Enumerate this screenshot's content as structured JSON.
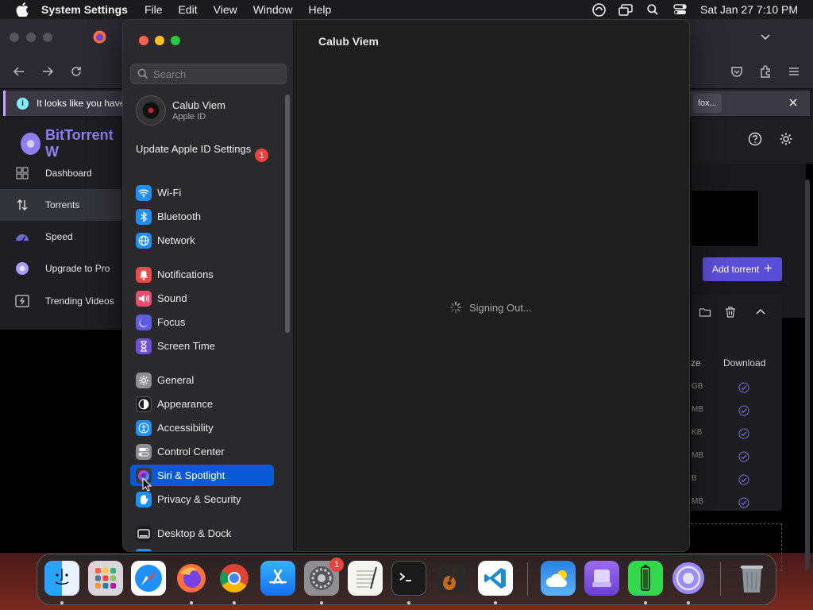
{
  "menubar": {
    "app_name": "System Settings",
    "menus": [
      "File",
      "Edit",
      "View",
      "Window",
      "Help"
    ],
    "clock": "Sat Jan 27  7:10 PM"
  },
  "browser": {
    "infobar_text": "It looks like you have",
    "infobar_button": "fox...",
    "bittorrent": {
      "logo_text": "BitTorrent W",
      "nav": [
        {
          "label": "Dashboard",
          "icon": "grid-icon"
        },
        {
          "label": "Torrents",
          "icon": "up-down-arrows-icon"
        },
        {
          "label": "Speed",
          "icon": "speedometer-icon"
        },
        {
          "label": "Upgrade to Pro",
          "icon": "bittorrent-logo-icon"
        },
        {
          "label": "Trending Videos",
          "icon": "video-icon"
        }
      ],
      "add_torrent": "Add torrent",
      "table": {
        "size_header": "ze",
        "download_header": "Download",
        "sizes": [
          "GB",
          "MB",
          "KB",
          "MB",
          "B",
          "MB"
        ]
      }
    }
  },
  "settings": {
    "search_placeholder": "Search",
    "account": {
      "name": "Calub Viem",
      "sub": "Apple ID"
    },
    "update": {
      "label": "Update Apple ID Settings",
      "badge": "1"
    },
    "groups": [
      [
        {
          "label": "Wi-Fi",
          "icon": "wifi-icon",
          "color": "#1f8ff5"
        },
        {
          "label": "Bluetooth",
          "icon": "bluetooth-icon",
          "color": "#1f8ff5"
        },
        {
          "label": "Network",
          "icon": "globe-icon",
          "color": "#1f8ff5"
        }
      ],
      [
        {
          "label": "Notifications",
          "icon": "bell-icon",
          "color": "#ea4c4c"
        },
        {
          "label": "Sound",
          "icon": "speaker-icon",
          "color": "#ea4c6c"
        },
        {
          "label": "Focus",
          "icon": "moon-icon",
          "color": "#5e5ce6"
        },
        {
          "label": "Screen Time",
          "icon": "hourglass-icon",
          "color": "#6f4fd8"
        }
      ],
      [
        {
          "label": "General",
          "icon": "gear-icon",
          "color": "#8e8e93"
        },
        {
          "label": "Appearance",
          "icon": "appearance-icon",
          "color": "#1c1c1e"
        },
        {
          "label": "Accessibility",
          "icon": "accessibility-icon",
          "color": "#1f8ff5"
        },
        {
          "label": "Control Center",
          "icon": "toggles-icon",
          "color": "#8e8e93"
        },
        {
          "label": "Siri & Spotlight",
          "icon": "siri-icon",
          "color": "#3a3a3c"
        },
        {
          "label": "Privacy & Security",
          "icon": "hand-icon",
          "color": "#1f8ff5"
        }
      ],
      [
        {
          "label": "Desktop & Dock",
          "icon": "dock-icon",
          "color": "#1c1c1e"
        }
      ]
    ],
    "selected_item": "Siri & Spotlight",
    "content_title": "Calub Viem",
    "status_text": "Signing Out..."
  },
  "dock": {
    "apps": [
      {
        "name": "finder",
        "running": true
      },
      {
        "name": "launchpad",
        "running": false
      },
      {
        "name": "safari",
        "running": false
      },
      {
        "name": "firefox",
        "running": true
      },
      {
        "name": "chrome",
        "running": true
      },
      {
        "name": "app-store",
        "running": false
      },
      {
        "name": "system-settings",
        "running": true,
        "badge": "1"
      },
      {
        "name": "textedit",
        "running": false
      },
      {
        "name": "terminal",
        "running": true
      },
      {
        "name": "garageband",
        "running": false
      },
      {
        "name": "vscode",
        "running": true
      },
      {
        "name": "weather",
        "running": false
      },
      {
        "name": "disk-utility",
        "running": false
      },
      {
        "name": "battery-app",
        "running": true
      },
      {
        "name": "bittorrent",
        "running": true
      },
      {
        "name": "trash",
        "running": false
      }
    ]
  }
}
